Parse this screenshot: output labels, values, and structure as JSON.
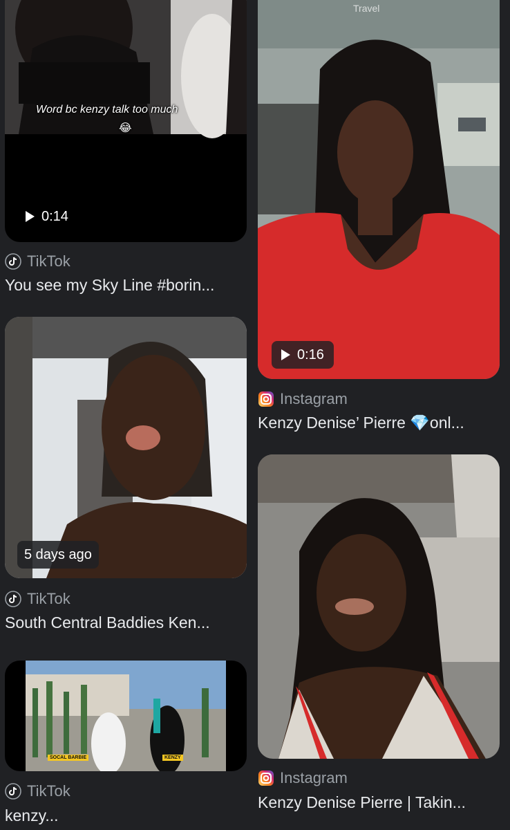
{
  "results": [
    {
      "thumb_caption": "Word bc kenzy talk too much",
      "caption_emoji": "😂",
      "badge": "0:14",
      "badge_type": "play",
      "source": "TikTok",
      "source_icon": "tiktok-icon",
      "title": "You see my Sky Line #borin..."
    },
    {
      "watermark": "Travel",
      "badge": "0:16",
      "badge_type": "play",
      "source": "Instagram",
      "source_icon": "instagram-icon",
      "title": "Kenzy Denise’ Pierre 💎onl..."
    },
    {
      "badge": "5 days ago",
      "badge_type": "text",
      "source": "TikTok",
      "source_icon": "tiktok-icon",
      "title": "South Central Baddies Ken..."
    },
    {
      "source": "Instagram",
      "source_icon": "instagram-icon",
      "title": "Kenzy Denise Pierre | Takin..."
    },
    {
      "lower_thirds": [
        "SOCAL BARBIE",
        "KENZY"
      ],
      "source": "TikTok",
      "source_icon": "tiktok-icon",
      "title": "kenzy..."
    }
  ],
  "colors": {
    "background": "#202124",
    "secondary_text": "#9aa0a6",
    "primary_text": "#e8eaed"
  }
}
